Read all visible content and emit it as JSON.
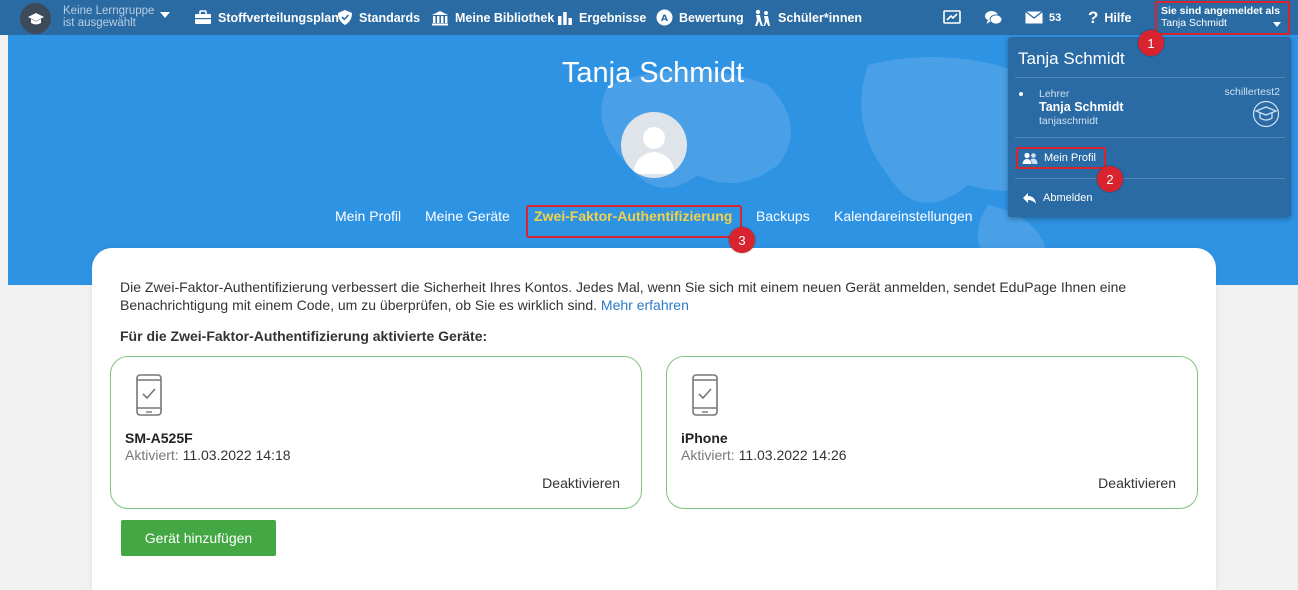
{
  "nav": {
    "learning_group": [
      "Keine Lerngruppe",
      "ist ausgewählt"
    ],
    "items": [
      {
        "label": "Stoffverteilungsplan",
        "icon": "briefcase-icon"
      },
      {
        "label": "Standards",
        "icon": "shield-icon"
      },
      {
        "label": "Meine Bibliothek",
        "icon": "library-icon"
      },
      {
        "label": "Ergebnisse",
        "icon": "bar-chart-icon"
      },
      {
        "label": "Bewertung",
        "icon": "grade-icon"
      },
      {
        "label": "Schüler*innen",
        "icon": "students-icon"
      }
    ],
    "message_count": "53",
    "help": "Hilfe",
    "logged_in_title": "Sie sind angemeldet als",
    "logged_in_name": "Tanja Schmidt"
  },
  "hero": {
    "name": "Tanja Schmidt",
    "tabs": [
      "Mein Profil",
      "Meine Geräte",
      "Zwei-Faktor-Authentifizierung",
      "Backups",
      "Kalendareinstellungen"
    ],
    "active_tab": "Zwei-Faktor-Authentifizierung"
  },
  "content": {
    "intro": "Die Zwei-Faktor-Authentifizierung verbessert die Sicherheit Ihres Kontos. Jedes Mal, wenn Sie sich mit einem neuen Gerät anmelden, sendet EduPage Ihnen eine Benachrichtigung mit einem Code, um zu überprüfen, ob Sie es wirklich sind.",
    "more_link": "Mehr erfahren",
    "heading": "Für die Zwei-Faktor-Authentifizierung aktivierte Geräte:",
    "devices": [
      {
        "name": "SM-A525F",
        "activated_label": "Aktiviert:",
        "activated": "11.03.2022 14:18",
        "action": "Deaktivieren"
      },
      {
        "name": "iPhone",
        "activated_label": "Aktiviert:",
        "activated": "11.03.2022 14:26",
        "action": "Deaktivieren"
      }
    ],
    "add_button": "Gerät hinzufügen"
  },
  "dropdown": {
    "name": "Tanja Schmidt",
    "role": "Lehrer",
    "user": "Tanja Schmidt",
    "login": "tanjaschmidt",
    "school": "schillertest2",
    "profile": "Mein Profil",
    "logout": "Abmelden"
  },
  "markers": [
    "1",
    "2",
    "3"
  ],
  "colors": {
    "nav": "#2b6ba3",
    "hero": "#2f93e4",
    "active_tab": "#f2d24a",
    "highlight": "#d9232e",
    "button": "#43a843",
    "device_border": "#7fc47f"
  }
}
